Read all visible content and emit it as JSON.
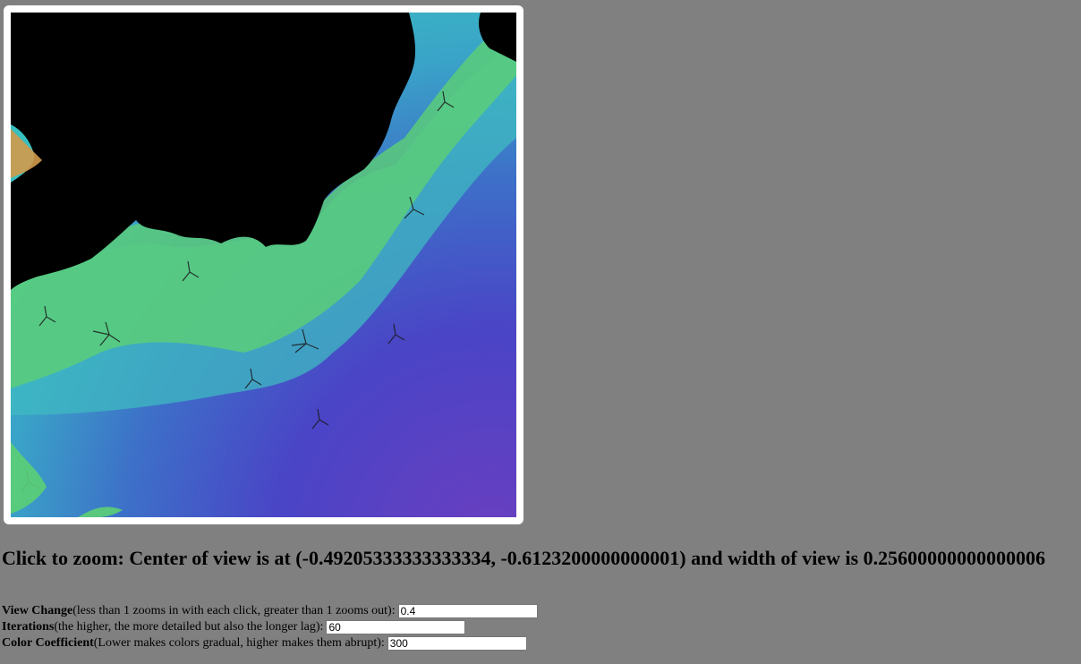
{
  "canvas": {
    "description_icon": "fractal-render"
  },
  "heading": {
    "prefix": "Click to zoom: Center of view is at (",
    "center_x": "-0.49205333333333334",
    "center_sep": ", ",
    "center_y": "-0.6123200000000001",
    "mid": ") and width of view is ",
    "width": "0.25600000000000006"
  },
  "controls": {
    "view_change": {
      "label": "View Change",
      "hint": " (less than 1 zooms in with each click, greater than 1 zooms out):",
      "value": "0.4"
    },
    "iterations": {
      "label": "Iterations",
      "hint": " (the higher, the more detailed but also the longer lag):",
      "value": "60"
    },
    "color_coefficient": {
      "label": "Color Coefficient",
      "hint": " (Lower makes colors gradual, higher makes them abrupt):",
      "value": "300"
    }
  },
  "colors": {
    "page_background": "#808080",
    "frame": "#ffffff",
    "set_interior": "#000000",
    "near_edge": "#e8a050",
    "mid_teal": "#3fbfbf",
    "far_blue": "#4a4fc8",
    "far_purple": "#6a40c0"
  }
}
